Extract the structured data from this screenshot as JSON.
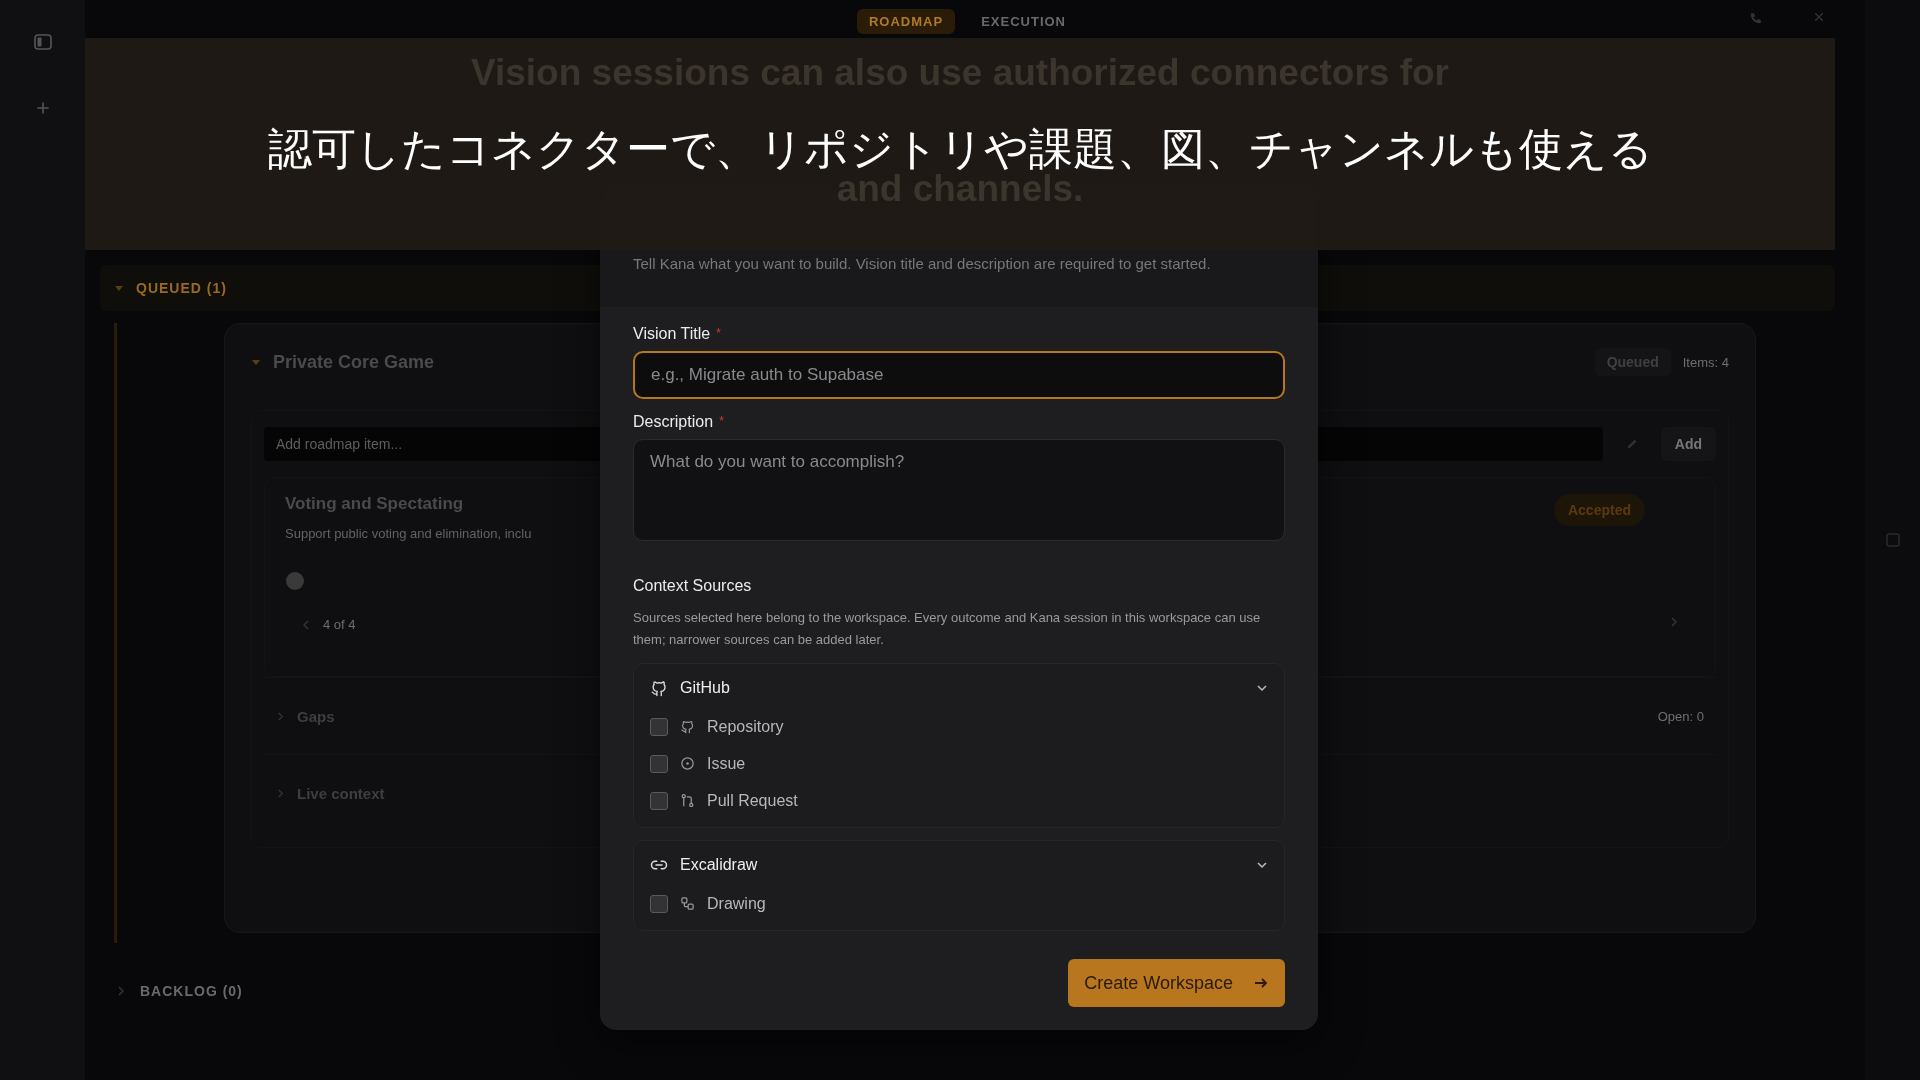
{
  "top_tabs": [
    {
      "label": "ROADMAP",
      "selected": true
    },
    {
      "label": "EXECUTION",
      "selected": false
    }
  ],
  "queued_section": {
    "label": "QUEUED (1)",
    "expanded": true
  },
  "card": {
    "title": "Private Core Game",
    "expanded": true,
    "status": "Queued",
    "items_count": "Items: 4",
    "add_field": {
      "placeholder": "Add roadmap item..."
    },
    "add_button": "Add",
    "item": {
      "title": "Voting and Spectating",
      "description": "Support public voting and elimination, inclu",
      "badge": "Accepted",
      "pager": "4 of 4"
    },
    "sections": [
      {
        "title": "Gaps",
        "count": "Open: 0"
      },
      {
        "title": "Live context"
      }
    ]
  },
  "backlog_section": {
    "label": "BACKLOG (0)",
    "expanded": false
  },
  "subtitle": {
    "caption": "認可したコネクターで、リポジトリや課題、図、チャンネルも使える",
    "original_lines": [
      "Vision sessions can also use authorized connectors for",
      "and channels."
    ]
  },
  "modal": {
    "intro": "Tell Kana what you want to build. Vision title and description are required to get started.",
    "fields": [
      {
        "label": "Vision Title",
        "required_mark": "*",
        "placeholder": "e.g., Migrate auth to Supabase",
        "focused": true,
        "kind": "input"
      },
      {
        "label": "Description",
        "required_mark": "*",
        "placeholder": "What do you want to accomplish?",
        "focused": false,
        "kind": "textarea"
      }
    ],
    "context_title": "Context Sources",
    "context_help": "Sources selected here belong to the workspace. Every outcome and Kana session in this workspace can use them; narrower sources can be added later.",
    "source_groups": [
      {
        "name": "GitHub",
        "kind": "github",
        "expanded": true,
        "items": [
          {
            "label": "Repository",
            "kind": "repository",
            "checked": false
          },
          {
            "label": "Issue",
            "kind": "issue",
            "checked": false
          },
          {
            "label": "Pull Request",
            "kind": "pull",
            "checked": false
          }
        ]
      },
      {
        "name": "Excalidraw",
        "kind": "link",
        "expanded": true,
        "items": [
          {
            "label": "Drawing",
            "kind": "drawing",
            "checked": false
          }
        ]
      }
    ],
    "submit_button": "Create Workspace"
  }
}
